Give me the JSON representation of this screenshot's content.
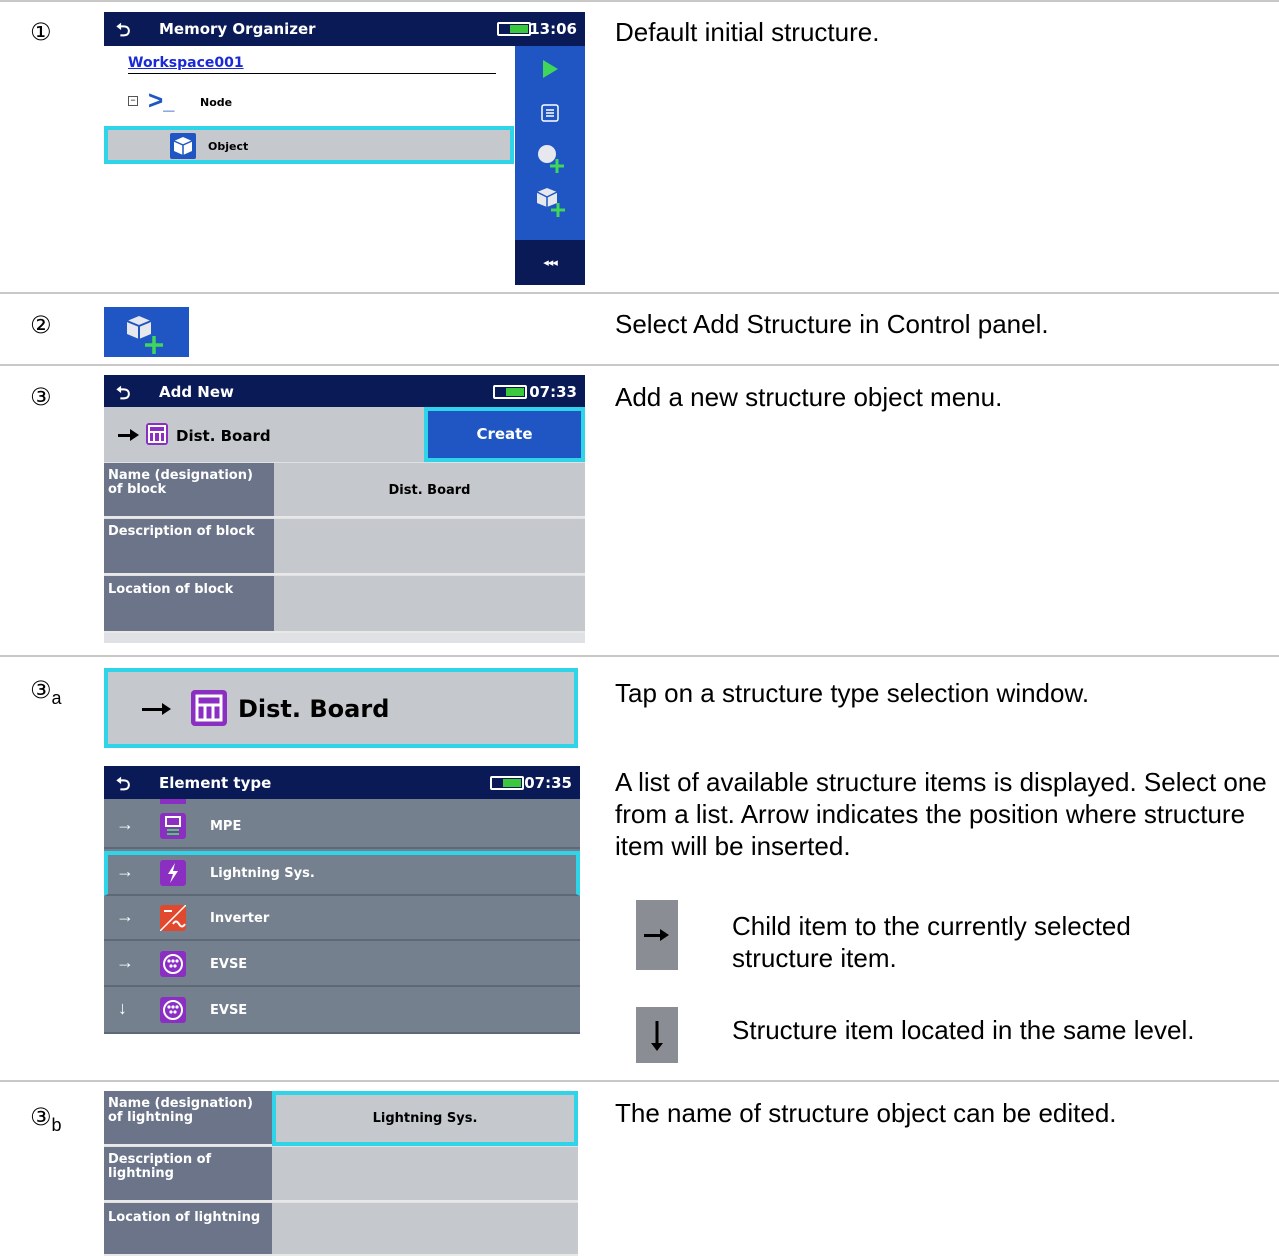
{
  "steps": [
    {
      "marker": "①",
      "sub": "",
      "description": "Default initial structure."
    },
    {
      "marker": "②",
      "sub": "",
      "description": "Select Add Structure in Control panel."
    },
    {
      "marker": "③",
      "sub": "",
      "description": "Add a new structure object menu."
    },
    {
      "marker": "③",
      "sub": "a",
      "description": "Tap on a structure type selection window.",
      "description2": "A list of available structure items is displayed. Select one from a list. Arrow indicates the position where structure item will be inserted."
    },
    {
      "marker": "③",
      "sub": "b",
      "description": "The name of structure object can be edited."
    }
  ],
  "legend": {
    "child": "Child item to the currently selected structure item.",
    "same": "Structure item located in the same level."
  },
  "screen1": {
    "title": "Memory Organizer",
    "time": "13:06",
    "workspace": "Workspace001",
    "node": "Node",
    "object": "Object",
    "side_more": "◂◂◂"
  },
  "screen3": {
    "title": "Add New",
    "time": "07:33",
    "type": "Dist. Board",
    "create": "Create",
    "fields": [
      {
        "label": "Name (designation) of block",
        "value": "Dist. Board"
      },
      {
        "label": "Description of block",
        "value": ""
      },
      {
        "label": "Location of block",
        "value": ""
      }
    ]
  },
  "screen3a": {
    "type": "Dist. Board",
    "title": "Element type",
    "time": "07:35",
    "items": [
      {
        "arrow": "→",
        "label": "MPE",
        "color": "#8a2fc1"
      },
      {
        "arrow": "→",
        "label": "Lightning Sys.",
        "color": "#8a2fc1"
      },
      {
        "arrow": "→",
        "label": "Inverter",
        "color": "#e0492e"
      },
      {
        "arrow": "→",
        "label": "EVSE",
        "color": "#8a2fc1"
      },
      {
        "arrow": "↓",
        "label": "EVSE",
        "color": "#8a2fc1"
      }
    ]
  },
  "screen3b": {
    "fields": [
      {
        "label": "Name (designation) of lightning",
        "value": "Lightning Sys."
      },
      {
        "label": "Description of lightning",
        "value": ""
      },
      {
        "label": "Location of lightning",
        "value": ""
      }
    ]
  },
  "colors": {
    "accent": "#2fd4e8",
    "header": "#0a1a57",
    "sidebar": "#1f56c4",
    "structure_icon": "#8a2fc1"
  }
}
